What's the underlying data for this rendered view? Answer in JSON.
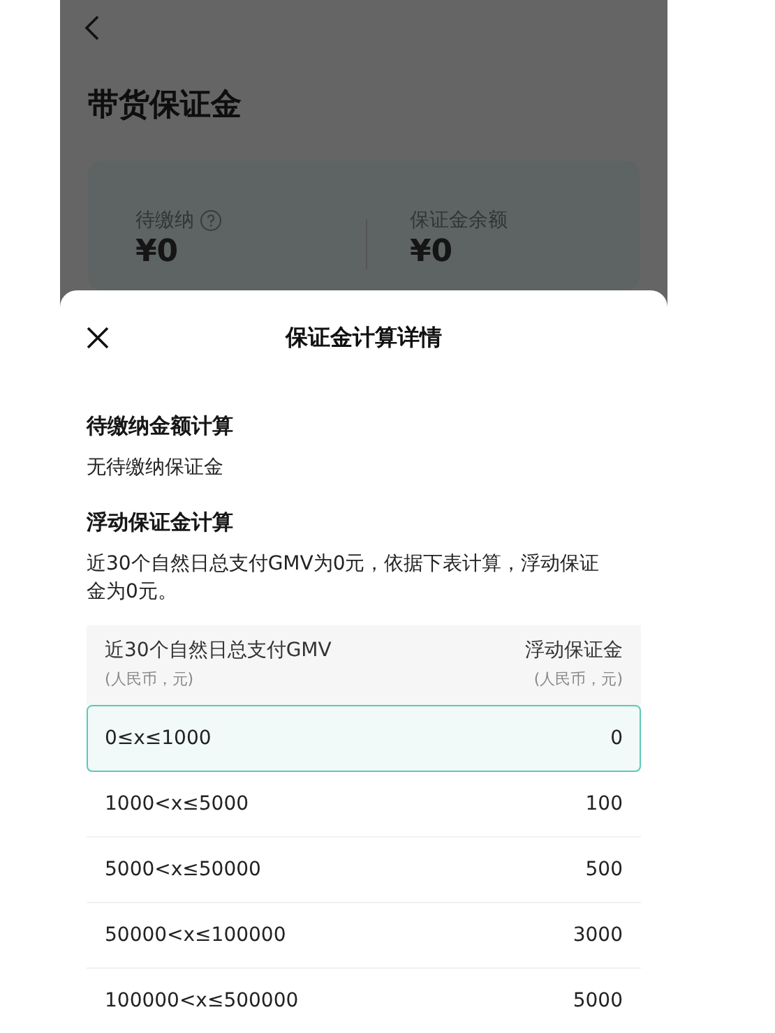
{
  "page": {
    "title": "带货保证金",
    "card": [
      {
        "label": "待缴纳",
        "help": true,
        "value": "¥0"
      },
      {
        "label": "保证金余额",
        "help": false,
        "value": "¥0"
      }
    ]
  },
  "sheet": {
    "title": "保证金计算详情",
    "sections": [
      {
        "heading": "待缴纳金额计算",
        "text": "无待缴纳保证金"
      },
      {
        "heading": "浮动保证金计算",
        "text": "近30个自然日总支付GMV为0元，依据下表计算，浮动保证金为0元。"
      }
    ],
    "table": {
      "columns": [
        {
          "title": "近30个自然日总支付GMV",
          "unit": "(人民币，元)"
        },
        {
          "title": "浮动保证金",
          "unit": "(人民币，元)"
        }
      ],
      "rows": [
        {
          "range": "0≤x≤1000",
          "amount": "0",
          "selected": true
        },
        {
          "range": "1000<x≤5000",
          "amount": "100",
          "selected": false
        },
        {
          "range": "5000<x≤50000",
          "amount": "500",
          "selected": false
        },
        {
          "range": "50000<x≤100000",
          "amount": "3000",
          "selected": false
        },
        {
          "range": "100000<x≤500000",
          "amount": "5000",
          "selected": false
        }
      ]
    }
  }
}
